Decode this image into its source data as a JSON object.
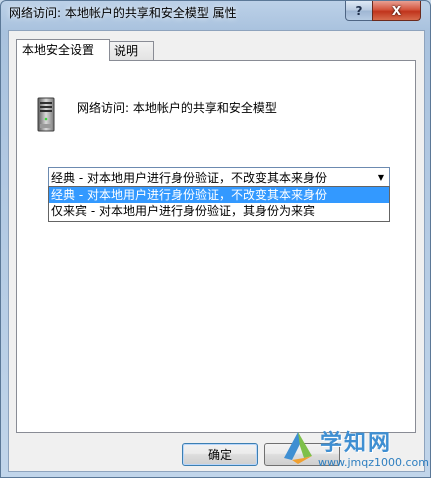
{
  "window": {
    "title": "网络访问: 本地帐户的共享和安全模型 属性",
    "help_label": "?",
    "close_label": "X"
  },
  "tabs": [
    {
      "label": "本地安全设置",
      "active": true
    },
    {
      "label": "说明",
      "active": false
    }
  ],
  "policy": {
    "icon": "server-icon",
    "title": "网络访问: 本地帐户的共享和安全模型"
  },
  "select": {
    "value": "经典 - 对本地用户进行身份验证，不改变其本来身份",
    "arrow": "▼",
    "options": [
      {
        "label": "经典 - 对本地用户进行身份验证，不改变其本来身份",
        "highlighted": true
      },
      {
        "label": "仅来宾 - 对本地用户进行身份验证，其身份为来宾",
        "highlighted": false
      }
    ]
  },
  "buttons": {
    "ok": "确定",
    "cancel": ""
  },
  "watermark": {
    "name": "学知网",
    "url": "www.jmqz1000.com"
  },
  "colors": {
    "selection": "#3399ff",
    "watermark_blue": "#3f8fd2"
  }
}
